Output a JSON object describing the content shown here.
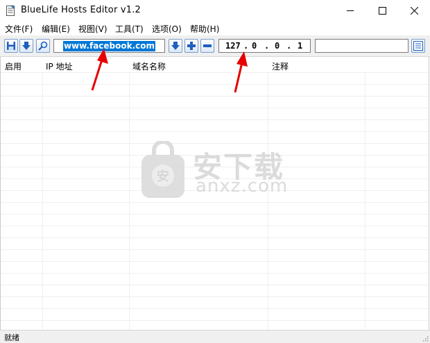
{
  "window": {
    "title": "BlueLife Hosts Editor v1.2"
  },
  "menu": [
    "文件(F)",
    "编辑(E)",
    "视图(V)",
    "工具(T)",
    "选项(O)",
    "帮助(H)"
  ],
  "toolbar": {
    "domain_value": "www.facebook.com",
    "ip_octets": [
      "127",
      "0",
      "0",
      "1"
    ],
    "ip_dots": [
      ".",
      ".",
      "."
    ],
    "comment_value": ""
  },
  "table": {
    "headers": [
      "启用",
      "IP 地址",
      "域名名称",
      "注释"
    ]
  },
  "watermark": {
    "cn": "安下载",
    "en": "anxz.com"
  },
  "status": {
    "text": "就绪"
  },
  "colors": {
    "selection": "#0078d7",
    "arrow": "#e60000",
    "toolbar_bg": "#f0f0f0"
  }
}
